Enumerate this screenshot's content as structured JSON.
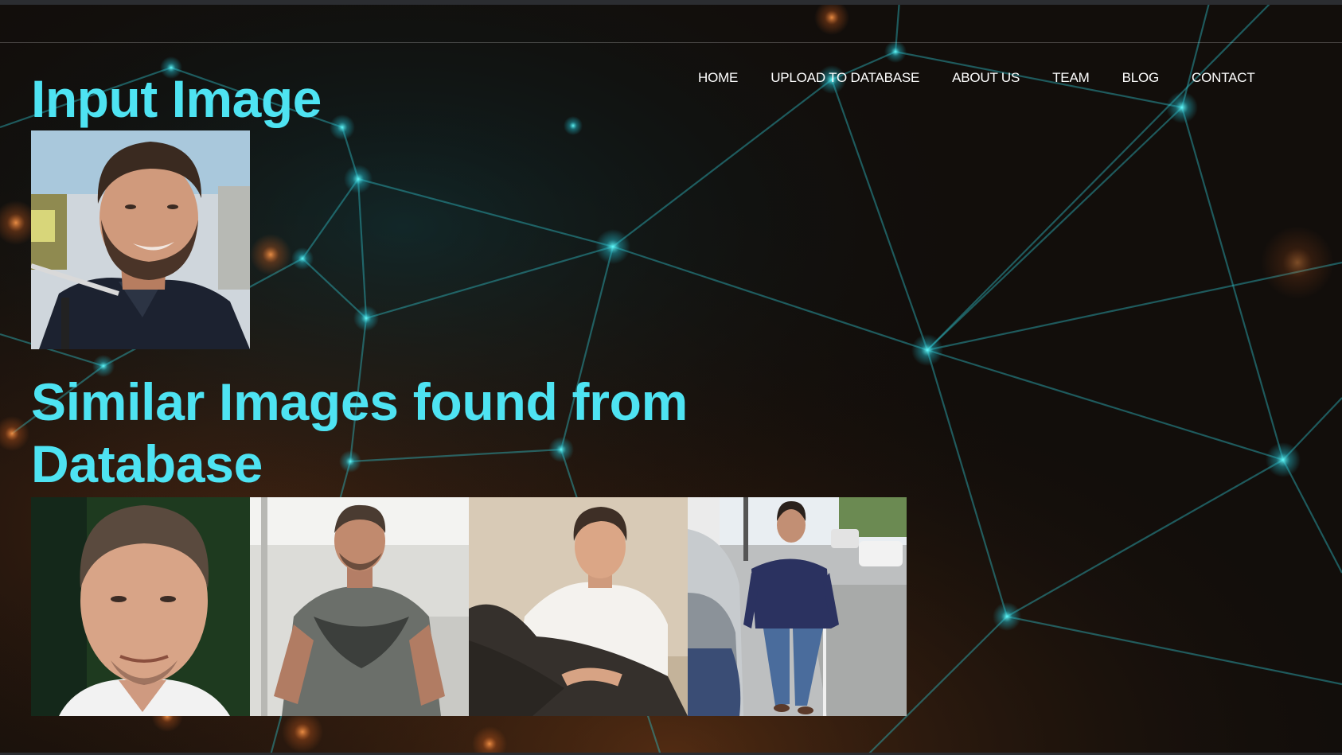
{
  "nav": {
    "items": [
      "HOME",
      "UPLOAD TO DATABASE",
      "ABOUT US",
      "TEAM",
      "BLOG",
      "CONTACT"
    ]
  },
  "main": {
    "input_title": "Input Image",
    "similar_title": "Similar Images found from Database"
  },
  "colors": {
    "title": "#4ee3f2",
    "background": "#0f0c0a",
    "network_node": "#3fd6d8",
    "nav_text": "#ffffff"
  }
}
